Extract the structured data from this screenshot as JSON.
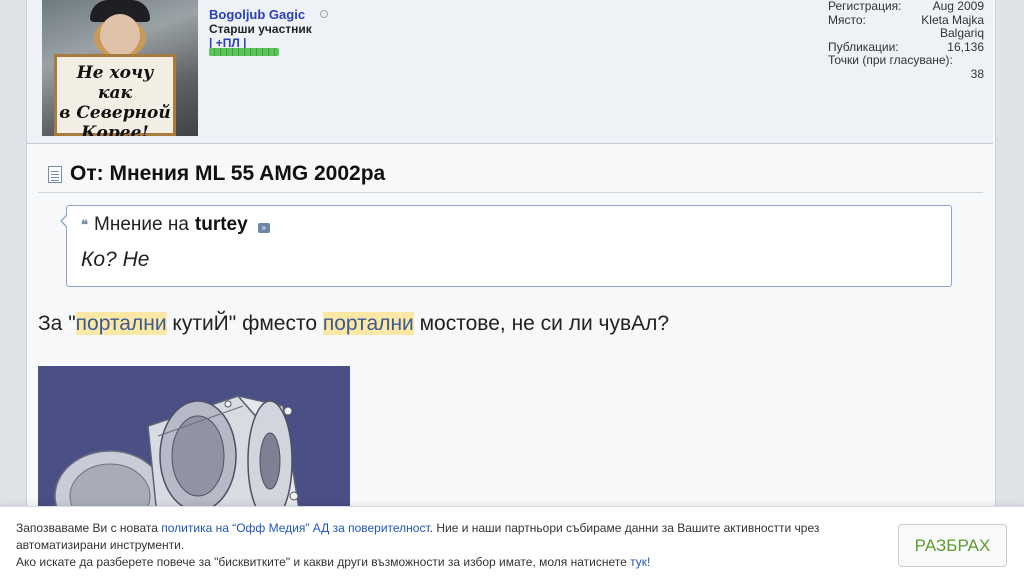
{
  "user": {
    "name": "Bogoljub Gagic",
    "title": "Старши участник",
    "group": "| +ПЛ |",
    "avatar_sign_text": "Не хочу как в Северной Корее!"
  },
  "stats": {
    "reg_label": "Регистрация:",
    "reg_value": "Aug 2009",
    "place_label": "Място:",
    "place_value_1": "Kleta Majka",
    "place_value_2": "Balgariq",
    "posts_label": "Публикации:",
    "posts_value": "16,136",
    "points_label": "Точки (при гласуване):",
    "points_value": "38"
  },
  "post": {
    "title": "От: Мнения ML 55 AMG 2002ра",
    "quote_prefix": "Мнение на",
    "quote_author": "turtey",
    "quote_text": "Ко? Не",
    "msg_1": "За \"",
    "msg_hl_1": "портални",
    "msg_2": " кутиЙ\" фместо ",
    "msg_hl_2": "портални",
    "msg_3": " мостове, не си ли чувАл?"
  },
  "cookie": {
    "t1": "Запозваваме Ви с новата ",
    "link1": "политика на “Офф Медия” АД за поверителност",
    "t2": ". Ние и наши партньори събираме данни за Вашите активностти чрез автоматизирани инструменти.",
    "t3": "Ако искате да разберете повече за \"бисквитките\" и какви други възможности за избор имате, моля натиснете ",
    "link2": "тук!",
    "accept_label": "РАЗБРАХ"
  }
}
